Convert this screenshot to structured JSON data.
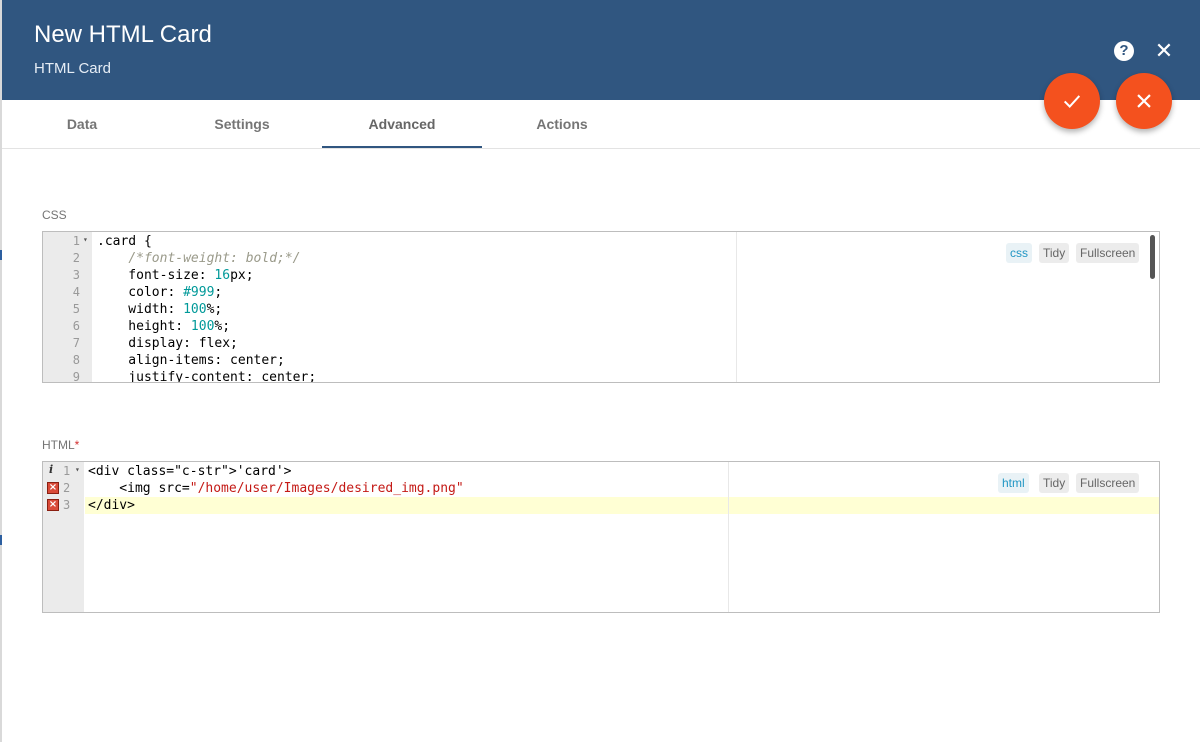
{
  "dialog": {
    "title": "New HTML Card",
    "subtitle": "HTML Card",
    "help_icon": "?",
    "close_icon": "✕"
  },
  "tabs": [
    {
      "label": "Data",
      "active": false
    },
    {
      "label": "Settings",
      "active": false
    },
    {
      "label": "Advanced",
      "active": true
    },
    {
      "label": "Actions",
      "active": false
    }
  ],
  "css_editor": {
    "label": "CSS",
    "mode_label": "css",
    "tidy_label": "Tidy",
    "fullscreen_label": "Fullscreen",
    "line_numbers": [
      "1",
      "2",
      "3",
      "4",
      "5",
      "6",
      "7",
      "8",
      "9"
    ],
    "lines": [
      ".card {",
      "    /*font-weight: bold;*/",
      "    font-size: 16px;",
      "    color: #999;",
      "    width: 100%;",
      "    height: 100%;",
      "    display: flex;",
      "    align-items: center;",
      "    justify-content: center;"
    ]
  },
  "html_editor": {
    "label": "HTML",
    "required_mark": "*",
    "mode_label": "html",
    "tidy_label": "Tidy",
    "fullscreen_label": "Fullscreen",
    "line_numbers": [
      "1",
      "2",
      "3"
    ],
    "lines": [
      "<div class='card'>",
      "    <img src=\"/home/user/Images/desired_img.png\"",
      "</div>"
    ]
  },
  "colors": {
    "header": "#305680",
    "accent_fab": "#f4511e",
    "active_tab_underline": "#305680"
  },
  "icons": {
    "apply": "check-icon",
    "cancel": "close-icon"
  }
}
